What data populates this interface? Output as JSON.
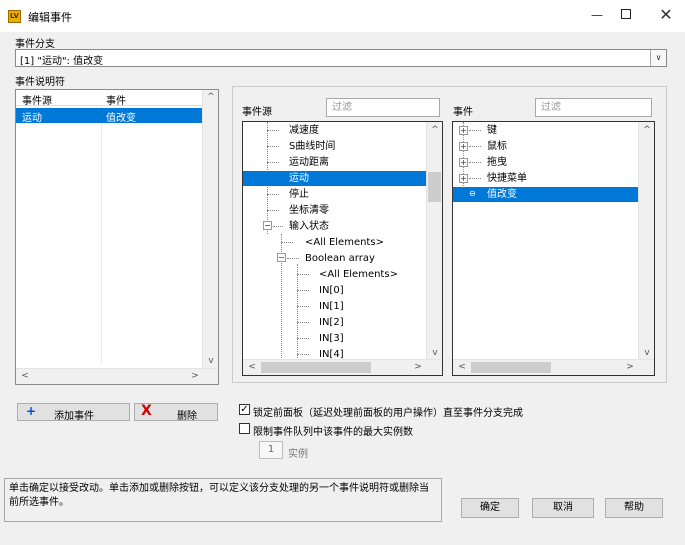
{
  "window": {
    "icon_text": "LV",
    "title": "编辑事件",
    "min_glyph": "—",
    "close_glyph": "✕"
  },
  "branch": {
    "label": "事件分支",
    "selected": "[1] \"运动\": 值改变",
    "dropdown_glyph": "∨"
  },
  "descriptors": {
    "label": "事件说明符",
    "col_source": "事件源",
    "col_event": "事件",
    "rows": [
      {
        "source": "运动",
        "event": "值改变"
      }
    ]
  },
  "sources_panel": {
    "label": "事件源",
    "filter_placeholder": "过滤",
    "items": [
      "减速度",
      "S曲线时间",
      "运动距离",
      "运动",
      "停止",
      "坐标清零",
      "输入状态",
      "<All Elements>",
      "Boolean array",
      "<All Elements>",
      "IN[0]",
      "IN[1]",
      "IN[2]",
      "IN[3]",
      "IN[4]"
    ],
    "selected_index": 3
  },
  "events_panel": {
    "label": "事件",
    "filter_placeholder": "过滤",
    "items": [
      "键",
      "鼠标",
      "拖曳",
      "快捷菜单",
      "值改变"
    ],
    "selected_index": 4
  },
  "scroll_glyphs": {
    "up": "^",
    "down": "v",
    "left": "<",
    "right": ">"
  },
  "actions": {
    "add_icon": "+",
    "add_label": "添加事件",
    "delete_icon": "X",
    "delete_label": "删除"
  },
  "options": {
    "lock_panel_label": "锁定前面板（延迟处理前面板的用户操作）直至事件分支完成",
    "lock_panel_checked": true,
    "limit_queue_label": "限制事件队列中该事件的最大实例数",
    "limit_queue_checked": false,
    "check_glyph": "✓",
    "instances_value": "1",
    "instances_label": "实例"
  },
  "help_text": "单击确定以接受改动。单击添加或删除按钮，可以定义该分支处理的另一个事件说明符或删除当前所选事件。",
  "buttons": {
    "ok": "确定",
    "cancel": "取消",
    "help": "帮助"
  }
}
